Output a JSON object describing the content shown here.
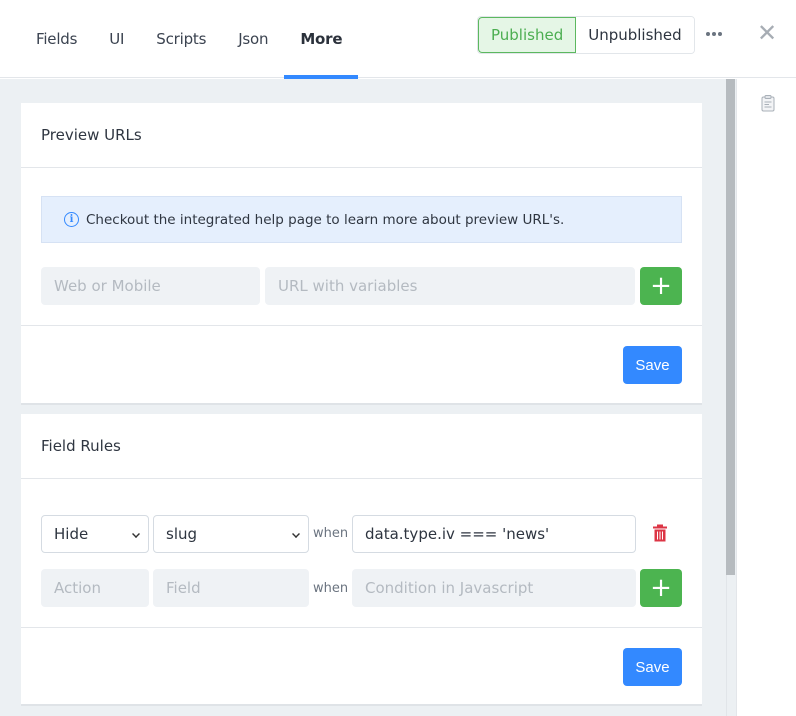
{
  "tabs": [
    {
      "label": "Fields",
      "active": false
    },
    {
      "label": "UI",
      "active": false
    },
    {
      "label": "Scripts",
      "active": false
    },
    {
      "label": "Json",
      "active": false
    },
    {
      "label": "More",
      "active": true
    }
  ],
  "status": {
    "published_label": "Published",
    "unpublished_label": "Unpublished",
    "selected": "Published"
  },
  "icons": {
    "more": "more-horizontal-icon",
    "close": "close-icon",
    "clipboard": "clipboard-icon",
    "info": "info-circle-icon",
    "add": "plus-icon",
    "delete": "trash-icon"
  },
  "colors": {
    "accent": "#3389ff",
    "success": "#4cb450",
    "danger": "#dc3545",
    "published_bg": "#e5f6e6"
  },
  "preview_urls": {
    "title": "Preview URLs",
    "info_text": "Checkout the integrated help page to learn more about preview URL's.",
    "name_placeholder": "Web or Mobile",
    "url_placeholder": "URL with variables",
    "save_label": "Save"
  },
  "field_rules": {
    "title": "Field Rules",
    "rules": [
      {
        "action": "Hide",
        "field": "slug",
        "when_label": "when",
        "condition": "data.type.iv === 'news'"
      }
    ],
    "new_rule": {
      "action_placeholder": "Action",
      "field_placeholder": "Field",
      "when_label": "when",
      "condition_placeholder": "Condition in Javascript"
    },
    "save_label": "Save"
  },
  "close_symbol": "✕",
  "plus_symbol": "+",
  "info_symbol": "i"
}
